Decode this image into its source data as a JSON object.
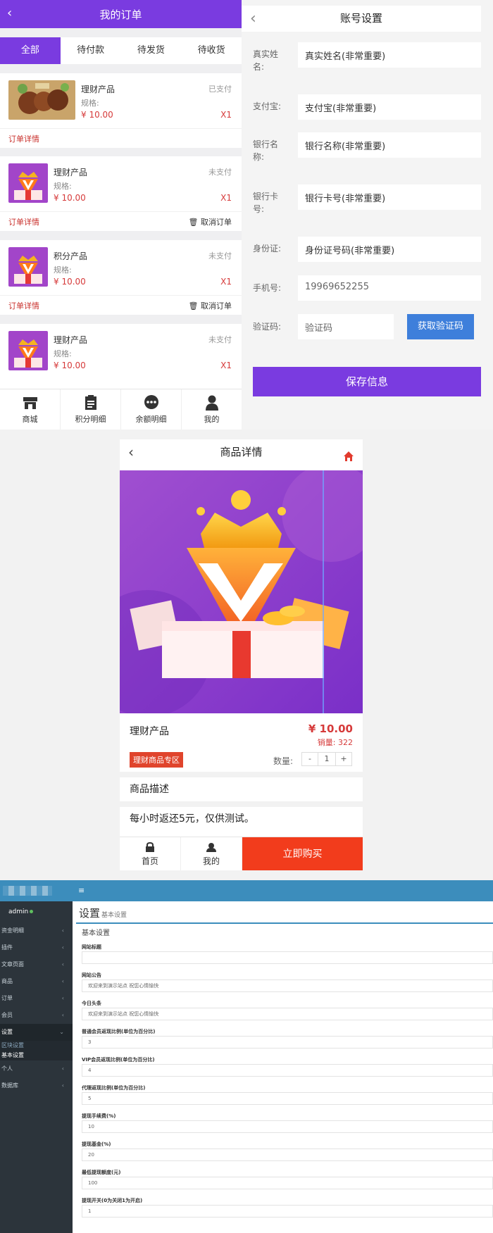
{
  "orders": {
    "title": "我的订单",
    "back_icon": "‹",
    "tabs": [
      "全部",
      "待付款",
      "待发货",
      "待收货"
    ],
    "items": [
      {
        "name": "理财产品",
        "spec": "规格:",
        "price": "¥ 10.00",
        "status": "已支付",
        "qty": "X1",
        "detail": "订单详情",
        "cancel": "",
        "thumb": "food"
      },
      {
        "name": "理财产品",
        "spec": "规格:",
        "price": "¥ 10.00",
        "status": "未支付",
        "qty": "X1",
        "detail": "订单详情",
        "cancel": "取消订单",
        "thumb": "gift"
      },
      {
        "name": "积分产品",
        "spec": "规格:",
        "price": "¥ 10.00",
        "status": "未支付",
        "qty": "X1",
        "detail": "订单详情",
        "cancel": "取消订单",
        "thumb": "gift"
      },
      {
        "name": "理财产品",
        "spec": "规格:",
        "price": "¥ 10.00",
        "status": "未支付",
        "qty": "X1",
        "detail": "",
        "cancel": "",
        "thumb": "gift"
      }
    ],
    "bottom_nav": [
      "商城",
      "积分明细",
      "余额明细",
      "我的"
    ]
  },
  "account": {
    "title": "账号设置",
    "fields": [
      {
        "label": "真实姓名:",
        "value": "真实姓名(非常重要)"
      },
      {
        "label": "支付宝:",
        "value": "支付宝(非常重要)"
      },
      {
        "label": "银行名称:",
        "value": "银行名称(非常重要)"
      },
      {
        "label": "银行卡号:",
        "value": "银行卡号(非常重要)"
      },
      {
        "label": "身份证:",
        "value": "身份证号码(非常重要)"
      },
      {
        "label": "手机号:",
        "value": "19969652255"
      }
    ],
    "code_label": "验证码:",
    "code_placeholder": "验证码",
    "code_button": "获取验证码",
    "save_button": "保存信息"
  },
  "product": {
    "title": "商品详情",
    "name": "理财产品",
    "price": "¥ 10.00",
    "sales": "销量: 322",
    "tag": "理财商品专区",
    "qty_label": "数量:",
    "qty_minus": "-",
    "qty_value": "1",
    "qty_plus": "+",
    "desc_title": "商品描述",
    "desc_text": "每小时返还5元，仅供测试。",
    "nav_home": "首页",
    "nav_mine": "我的",
    "buy_button": "立即购买"
  },
  "admin": {
    "username": "admin",
    "menu_toggle": "≡",
    "title": "设置",
    "subtitle": "基本设置",
    "box_title": "基本设置",
    "menu": [
      {
        "label": "资金明细",
        "type": "item"
      },
      {
        "label": "插件",
        "type": "item"
      },
      {
        "label": "文章页面",
        "type": "item"
      },
      {
        "label": "商品",
        "type": "item"
      },
      {
        "label": "订单",
        "type": "item"
      },
      {
        "label": "会员",
        "type": "item"
      },
      {
        "label": "设置",
        "type": "open"
      },
      {
        "label": "区块设置",
        "type": "sub"
      },
      {
        "label": "基本设置",
        "type": "sub-active"
      },
      {
        "label": "个人",
        "type": "item"
      },
      {
        "label": "数据库",
        "type": "item"
      }
    ],
    "fields": [
      {
        "label": "网站标题",
        "value": ""
      },
      {
        "label": "网站公告",
        "value": "欢迎来到演示站点 祝您心情愉快"
      },
      {
        "label": "今日头条",
        "value": "欢迎来到演示站点 祝您心情愉快"
      },
      {
        "label": "普通会员返现比例(单位为百分比)",
        "value": "3"
      },
      {
        "label": "VIP会员返现比例(单位为百分比)",
        "value": "4"
      },
      {
        "label": "代理返现比例(单位为百分比)",
        "value": "5"
      },
      {
        "label": "提现手续费(%)",
        "value": "10"
      },
      {
        "label": "提现基金(%)",
        "value": "20"
      },
      {
        "label": "最低提现额度(元)",
        "value": "100"
      },
      {
        "label": "提现开关(0为关闭1为开启)",
        "value": "1"
      }
    ]
  },
  "colors": {
    "purple": "#7a3be0",
    "red": "#d63a3a",
    "blue_button": "#3e7fdb",
    "buy_red": "#f23c1c",
    "admin_blue": "#3c8dbc",
    "admin_sidebar": "#2c343b"
  }
}
